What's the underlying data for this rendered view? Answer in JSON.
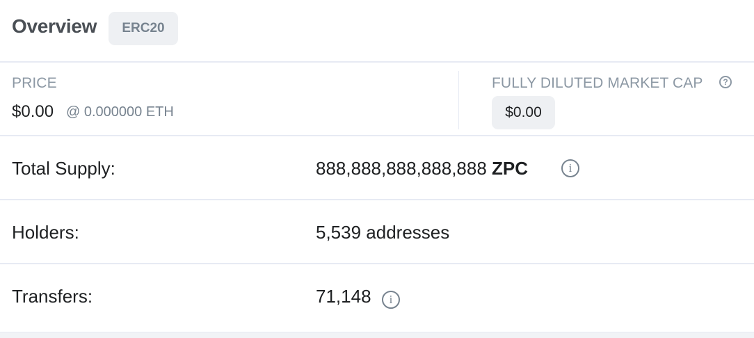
{
  "header": {
    "title": "Overview",
    "badge": "ERC20"
  },
  "price": {
    "label": "PRICE",
    "value": "$0.00",
    "eth": "@ 0.000000 ETH"
  },
  "market_cap": {
    "label": "FULLY DILUTED MARKET CAP",
    "help_icon": "question-circle-icon",
    "help_glyph": "?",
    "value": "$0.00"
  },
  "rows": {
    "total_supply": {
      "label": "Total Supply:",
      "amount": "888,888,888,888,888",
      "symbol": "ZPC",
      "info_icon": "info-circle-icon",
      "info_glyph": "i"
    },
    "holders": {
      "label": "Holders:",
      "value": "5,539 addresses"
    },
    "transfers": {
      "label": "Transfers:",
      "value": "71,148",
      "info_icon": "info-circle-icon",
      "info_glyph": "i"
    }
  },
  "colors": {
    "divider": "#e7eaf3",
    "badge_bg": "#eef0f3",
    "muted_text": "#8c98a4",
    "text": "#1e2022"
  }
}
